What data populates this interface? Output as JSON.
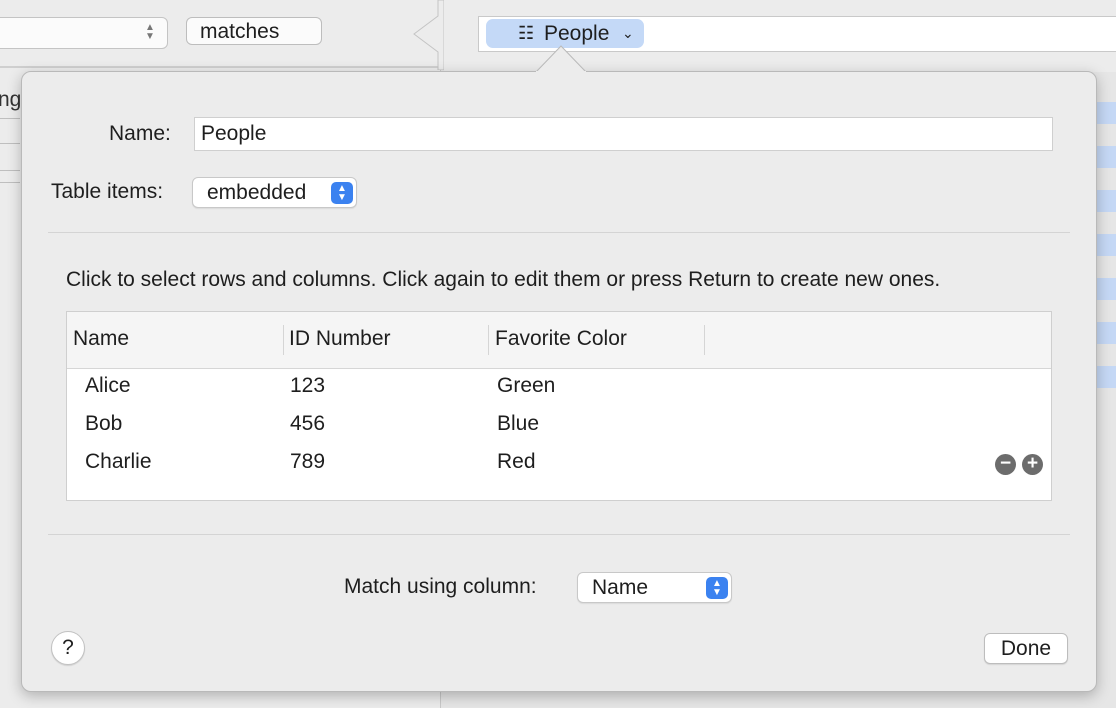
{
  "background": {
    "predicate_value": "matches",
    "partial_label": "ng",
    "token": {
      "icon": "table-icon",
      "label": "People",
      "chevron": "chevron-down-icon"
    }
  },
  "popover": {
    "name_label": "Name:",
    "name_value": "People",
    "table_items_label": "Table items:",
    "table_items_value": "embedded",
    "instructions": "Click to select rows and columns. Click again to edit them or press Return to create new ones.",
    "table": {
      "columns": [
        "Name",
        "ID Number",
        "Favorite Color"
      ],
      "rows": [
        [
          "Alice",
          "123",
          "Green"
        ],
        [
          "Bob",
          "456",
          "Blue"
        ],
        [
          "Charlie",
          "789",
          "Red"
        ]
      ],
      "remove_symbol": "−",
      "add_symbol": "+"
    },
    "match_label": "Match using column:",
    "match_value": "Name",
    "help_symbol": "?",
    "done_label": "Done"
  },
  "colors": {
    "accent": "#3b82f0",
    "token_bg": "#c4d9f7",
    "window_bg": "#ececec"
  }
}
